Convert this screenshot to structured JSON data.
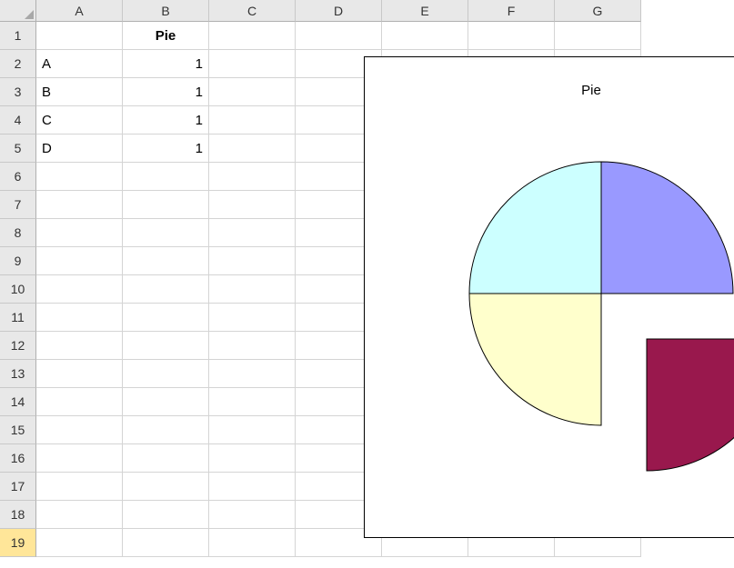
{
  "columns": [
    "A",
    "B",
    "C",
    "D",
    "E",
    "F",
    "G"
  ],
  "rows": [
    "1",
    "2",
    "3",
    "4",
    "5",
    "6",
    "7",
    "8",
    "9",
    "10",
    "11",
    "12",
    "13",
    "14",
    "15",
    "16",
    "17",
    "18",
    "19"
  ],
  "selected_row_index": 18,
  "header_cell_B1": "Pie",
  "data_rows": [
    {
      "label": "A",
      "value": "1"
    },
    {
      "label": "B",
      "value": "1"
    },
    {
      "label": "C",
      "value": "1"
    },
    {
      "label": "D",
      "value": "1"
    }
  ],
  "chart_data": {
    "type": "pie",
    "title": "Pie",
    "categories": [
      "A",
      "B",
      "C",
      "D"
    ],
    "values": [
      1,
      1,
      1,
      1
    ],
    "colors": [
      "#9999ff",
      "#99184d",
      "#ffffcc",
      "#ccffff"
    ],
    "exploded_slice_index": 1
  }
}
